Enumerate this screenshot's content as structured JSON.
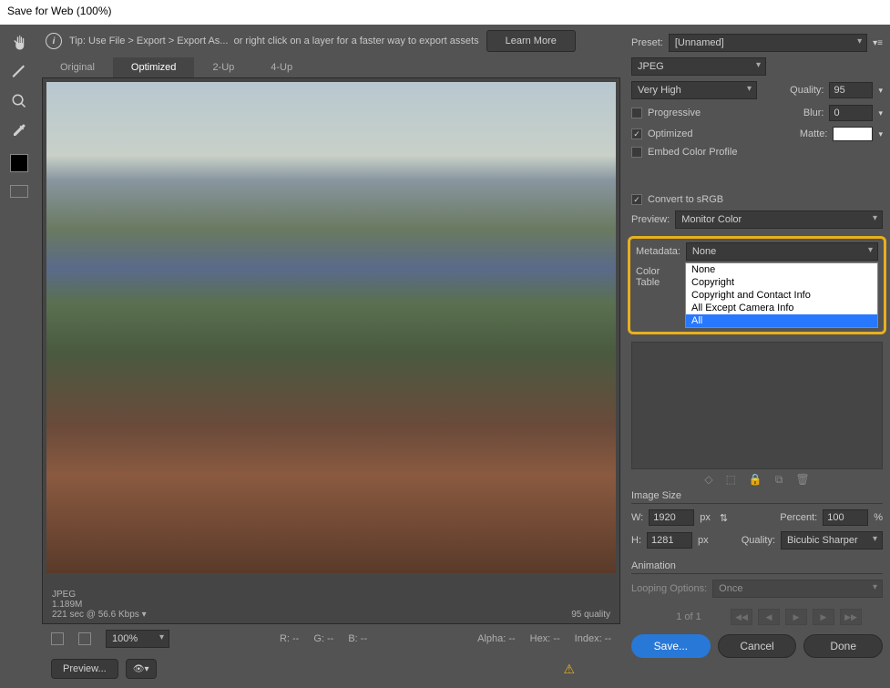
{
  "title": "Save for Web (100%)",
  "tip": {
    "label": "Tip:",
    "text1": "Use File > Export > Export As...",
    "text2": "or right click on a layer for a faster way to export assets",
    "learn": "Learn More"
  },
  "tabs": {
    "original": "Original",
    "optimized": "Optimized",
    "two_up": "2-Up",
    "four_up": "4-Up"
  },
  "imginfo": {
    "format": "JPEG",
    "size": "1.189M",
    "time": "221 sec @ 56.6 Kbps",
    "quality": "95 quality"
  },
  "zoom": "100%",
  "readouts": {
    "r": "R: --",
    "g": "G: --",
    "b": "B: --",
    "alpha": "Alpha: --",
    "hex": "Hex: --",
    "index": "Index: --"
  },
  "preview_btn": "Preview...",
  "right": {
    "preset_lbl": "Preset:",
    "preset_val": "[Unnamed]",
    "format": "JPEG",
    "quality_preset": "Very High",
    "quality_lbl": "Quality:",
    "quality_val": "95",
    "progressive": "Progressive",
    "blur_lbl": "Blur:",
    "blur_val": "0",
    "optimized": "Optimized",
    "matte_lbl": "Matte:",
    "embed": "Embed Color Profile",
    "convert": "Convert to sRGB",
    "preview_lbl": "Preview:",
    "preview_val": "Monitor Color",
    "metadata_lbl": "Metadata:",
    "metadata_val": "None",
    "dd": {
      "none": "None",
      "copyright": "Copyright",
      "contact": "Copyright and Contact Info",
      "except": "All Except Camera Info",
      "all": "All"
    },
    "colortable": "Color Table",
    "imgsize_hdr": "Image Size",
    "w_lbl": "W:",
    "w_val": "1920",
    "h_lbl": "H:",
    "h_val": "1281",
    "px": "px",
    "percent_lbl": "Percent:",
    "percent_val": "100",
    "pct": "%",
    "resample_lbl": "Quality:",
    "resample_val": "Bicubic Sharper",
    "anim_hdr": "Animation",
    "loop_lbl": "Looping Options:",
    "loop_val": "Once",
    "page": "1 of 1"
  },
  "actions": {
    "save": "Save...",
    "cancel": "Cancel",
    "done": "Done"
  }
}
